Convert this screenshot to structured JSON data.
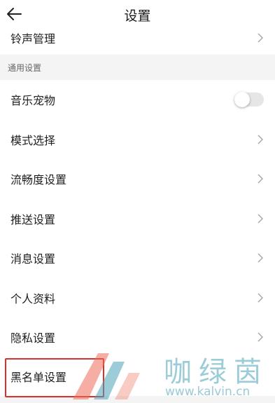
{
  "header": {
    "title": "设置",
    "back_icon": "arrow-left-icon"
  },
  "rows": {
    "ringtone": "铃声管理",
    "music_pet": "音乐宠物",
    "mode": "模式选择",
    "fluency": "流畅度设置",
    "push": "推送设置",
    "message": "消息设置",
    "profile": "个人资料",
    "privacy": "隐私设置",
    "blacklist": "黑名单设置"
  },
  "section": {
    "general": "通用设置"
  },
  "toggles": {
    "music_pet_on": false
  },
  "watermark": {
    "text": "咖绿茵",
    "url": "www.kalvin.cn"
  },
  "colors": {
    "highlight": "#d9302a",
    "watermark": "#4aa3b7",
    "section_bg": "#f4f4f4"
  }
}
